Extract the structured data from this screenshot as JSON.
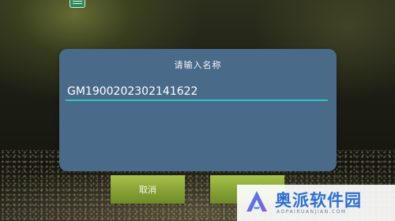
{
  "dialog": {
    "title": "请输入名称",
    "name_value": "GM1900202302141622"
  },
  "buttons": {
    "cancel_label": "取消",
    "confirm_label": ""
  },
  "watermark": {
    "name": "奥派软件园",
    "url": "AOPAIRUANJIAN.COM"
  },
  "colors": {
    "dialog_bg": "#4a6a8a",
    "input_underline": "#2fc5c2",
    "button_green": "#86a236",
    "watermark_blue": "#2f6fd1"
  },
  "icons": {
    "top_app_icon": "app-icon",
    "watermark_logo": "triangle-logo-icon"
  }
}
